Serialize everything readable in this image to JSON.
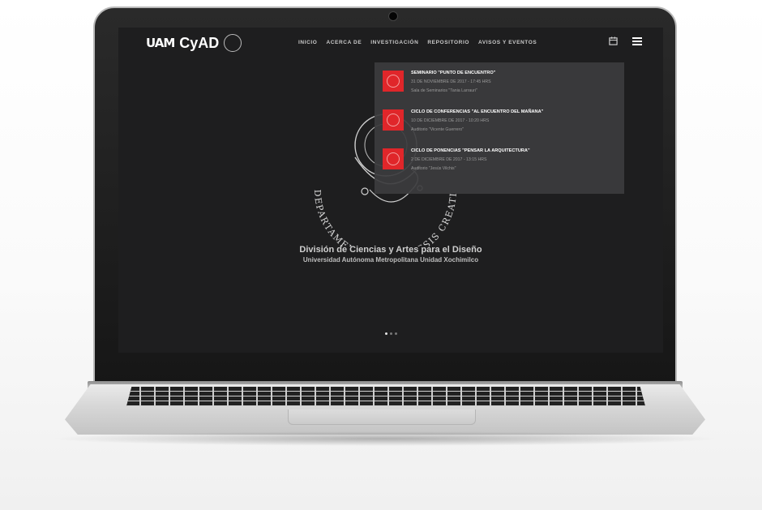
{
  "logo": {
    "text_uam": "UAM",
    "text_cya": "CyAD"
  },
  "nav": {
    "items": [
      "INICIO",
      "ACERCA DE",
      "INVESTIGACIÓN",
      "REPOSITORIO",
      "AVISOS Y EVENTOS"
    ]
  },
  "icons": {
    "calendar": "calendar-icon",
    "menu": "hamburger-menu-icon"
  },
  "hero": {
    "emblem_text": "DEPARTAMENTO DE SÍNTESIS CREATIVA",
    "title": "División de Ciencias y Artes para el Diseño",
    "subtitle": "Universidad Autónoma Metropolitana Unidad Xochimilco"
  },
  "carousel": {
    "active_index": 0,
    "count": 3
  },
  "events": [
    {
      "title": "SEMINARIO \"PUNTO DE ENCUENTRO\"",
      "date": "31 DE NOVIEMBRE DE 2017 - 17:45 HRS",
      "place": "Sala de Seminarios \"Tania Larrauri\""
    },
    {
      "title": "CICLO DE CONFERENCIAS \"AL ENCUENTRO DEL MAÑANA\"",
      "date": "10 DE DICIEMBRE DE 2017 - 10:20 HRS",
      "place": "Auditorio \"Vicente Guerrero\""
    },
    {
      "title": "CICLO DE PONENCIAS \"PENSAR LA ARQUITECTURA\"",
      "date": "2 DE DICIEMBRE DE 2017 - 13:15 HRS",
      "place": "Auditorio \"Jesús Vilchis\""
    }
  ],
  "colors": {
    "accent_red": "#e0262a",
    "screen_bg": "#1e1e1f",
    "panel_bg": "#3c3c3e"
  }
}
